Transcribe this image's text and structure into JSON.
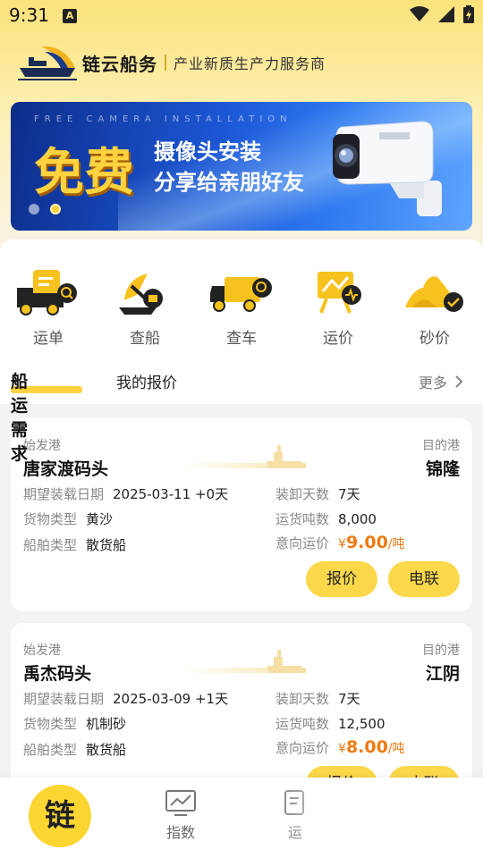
{
  "status_bar": {
    "time": "9:31",
    "notif_glyph": "A",
    "icons": [
      "wifi-icon",
      "signal-icon",
      "battery-icon"
    ]
  },
  "header": {
    "app_name": "链云船务",
    "slogan": "产业新质生产力服务商"
  },
  "banner": {
    "subtitle": "FREE CAMERA INSTALLATION",
    "big_text": "免费",
    "line1": "摄像头安装",
    "line2": "分享给亲朋好友",
    "active_dot": 2,
    "dot_count": 2
  },
  "quick_actions": [
    {
      "label": "运单",
      "icon": "waybill-truck-icon"
    },
    {
      "label": "查船",
      "icon": "ship-search-icon"
    },
    {
      "label": "查车",
      "icon": "truck-search-icon"
    },
    {
      "label": "运价",
      "icon": "freight-rate-icon"
    },
    {
      "label": "砂价",
      "icon": "sand-price-icon"
    }
  ],
  "tabs": {
    "active": "船运需求",
    "other": "我的报价",
    "more": "更多"
  },
  "demands": [
    {
      "origin_label": "始发港",
      "origin": "唐家渡码头",
      "dest_label": "目的港",
      "dest": "锦隆",
      "date_label": "期望装载日期",
      "date": "2025-03-11 +0天",
      "cargo_label": "货物类型",
      "cargo": "黄沙",
      "ship_label": "船舶类型",
      "ship": "散货船",
      "days_label": "装卸天数",
      "days": "7天",
      "tons_label": "运货吨数",
      "tons": "8,000",
      "price_label": "意向运价",
      "currency": "¥",
      "price": "9.00",
      "price_unit": "/吨",
      "quote_btn": "报价",
      "call_btn": "电联"
    },
    {
      "origin_label": "始发港",
      "origin": "禹杰码头",
      "dest_label": "目的港",
      "dest": "江阴",
      "date_label": "期望装载日期",
      "date": "2025-03-09 +1天",
      "cargo_label": "货物类型",
      "cargo": "机制砂",
      "ship_label": "船舶类型",
      "ship": "散货船",
      "days_label": "装卸天数",
      "days": "7天",
      "tons_label": "运货吨数",
      "tons": "12,500",
      "price_label": "意向运价",
      "currency": "¥",
      "price": "8.00",
      "price_unit": "/吨",
      "quote_btn": "报价",
      "call_btn": "电联"
    }
  ],
  "bottom_nav": {
    "home_glyph": "链",
    "items": [
      {
        "label": "指数",
        "icon": "chart-index-icon"
      },
      {
        "label": "运",
        "icon": "document-icon"
      },
      {
        "label": "",
        "icon": "lock-icon"
      }
    ]
  },
  "colors": {
    "accent": "#FBD84A",
    "price": "#EE7A12",
    "banner_blue": "#1C57D6"
  }
}
